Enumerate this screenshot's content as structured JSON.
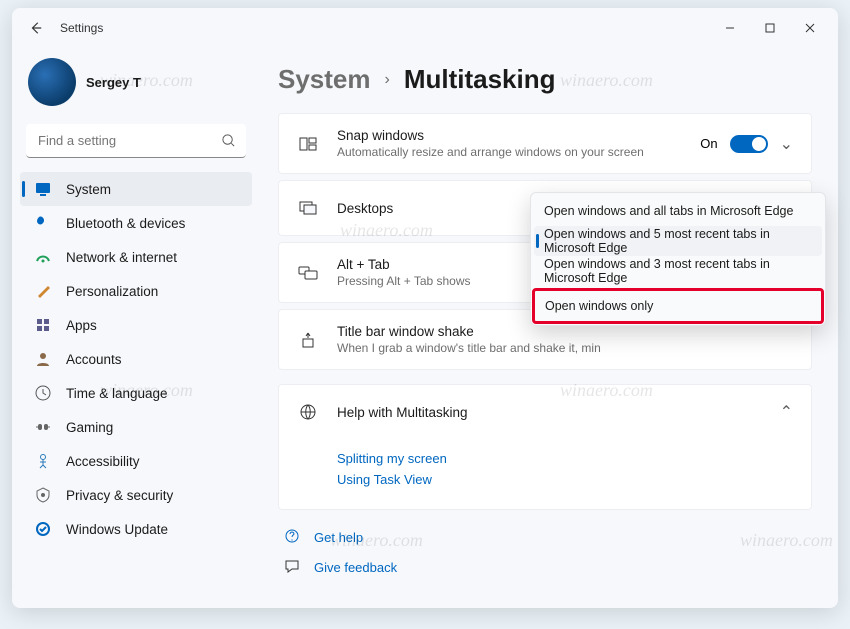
{
  "window_title": "Settings",
  "user_name": "Sergey T",
  "search_placeholder": "Find a setting",
  "breadcrumb": {
    "parent": "System",
    "current": "Multitasking"
  },
  "nav": [
    {
      "label": "System",
      "active": true
    },
    {
      "label": "Bluetooth & devices"
    },
    {
      "label": "Network & internet"
    },
    {
      "label": "Personalization"
    },
    {
      "label": "Apps"
    },
    {
      "label": "Accounts"
    },
    {
      "label": "Time & language"
    },
    {
      "label": "Gaming"
    },
    {
      "label": "Accessibility"
    },
    {
      "label": "Privacy & security"
    },
    {
      "label": "Windows Update"
    }
  ],
  "settings": {
    "snap": {
      "title": "Snap windows",
      "subtitle": "Automatically resize and arrange windows on your screen",
      "state_label": "On"
    },
    "desktops": {
      "title": "Desktops"
    },
    "alttab": {
      "title": "Alt + Tab",
      "subtitle": "Pressing Alt + Tab shows"
    },
    "shake": {
      "title": "Title bar window shake",
      "subtitle": "When I grab a window's title bar and shake it, min"
    }
  },
  "alttab_options": [
    "Open windows and all tabs in Microsoft Edge",
    "Open windows and 5 most recent tabs in Microsoft Edge",
    "Open windows and 3 most recent tabs in Microsoft Edge",
    "Open windows only"
  ],
  "alttab_selected_index": 1,
  "alttab_highlighted_index": 3,
  "help": {
    "title": "Help with Multitasking",
    "links": [
      "Splitting my screen",
      "Using Task View"
    ]
  },
  "footer": {
    "get_help": "Get help",
    "give_feedback": "Give feedback"
  },
  "watermark": "winaero.com"
}
